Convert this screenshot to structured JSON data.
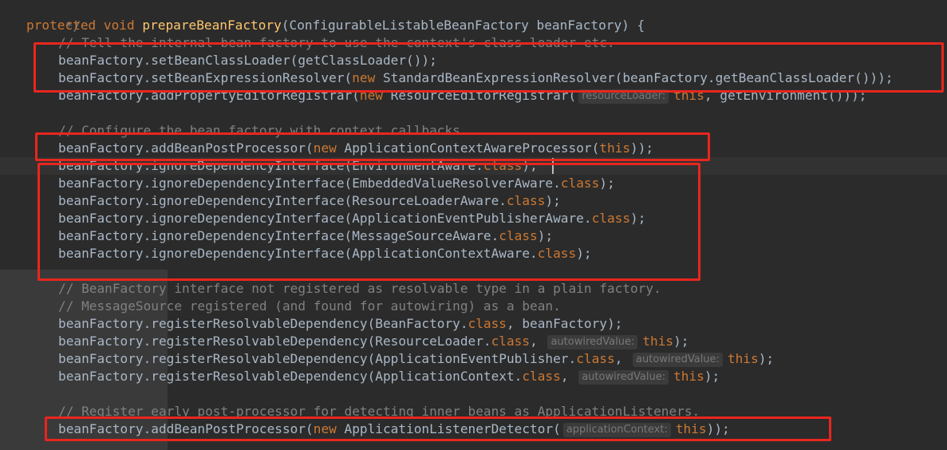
{
  "code": {
    "l0_comment_end": "*/",
    "l1": {
      "kw1": "protected",
      "kw2": "void",
      "method": "prepareBeanFactory",
      "params": "(ConfigurableListableBeanFactory beanFactory) {"
    },
    "l2_comment": "// Tell the internal bean factory to use the context's class loader etc.",
    "l3": "beanFactory.setBeanClassLoader(getClassLoader());",
    "l4": {
      "a": "beanFactory.setBeanExpressionResolver(",
      "kw": "new",
      "b": " StandardBeanExpressionResolver(beanFactory.getBeanClassLoader()));"
    },
    "l5": {
      "a": "beanFactory.addPropertyEditorRegistrar(",
      "kw": "new",
      "b": " ResourceEditorRegistrar(",
      "hint": "resourceLoader:",
      "this": "this",
      "c": ", getEnvironment()));"
    },
    "l6_comment": "// Configure the bean factory with context callbacks.",
    "l7": {
      "a": "beanFactory.addBeanPostProcessor(",
      "kw": "new",
      "b": " ApplicationContextAwareProcessor(",
      "this": "this",
      "c": "));"
    },
    "l8": {
      "a": "beanFactory.ignoreDependencyInterface(EnvironmentAware.",
      "kw": "class",
      "c": ");"
    },
    "l9": {
      "a": "beanFactory.ignoreDependencyInterface(EmbeddedValueResolverAware.",
      "kw": "class",
      "c": ");"
    },
    "l10": {
      "a": "beanFactory.ignoreDependencyInterface(ResourceLoaderAware.",
      "kw": "class",
      "c": ");"
    },
    "l11": {
      "a": "beanFactory.ignoreDependencyInterface(ApplicationEventPublisherAware.",
      "kw": "class",
      "c": ");"
    },
    "l12": {
      "a": "beanFactory.ignoreDependencyInterface(MessageSourceAware.",
      "kw": "class",
      "c": ");"
    },
    "l13": {
      "a": "beanFactory.ignoreDependencyInterface(ApplicationContextAware.",
      "kw": "class",
      "c": ");"
    },
    "l14_comment": "// BeanFactory interface not registered as resolvable type in a plain factory.",
    "l15_comment": "// MessageSource registered (and found for autowiring) as a bean.",
    "l16": {
      "a": "beanFactory.registerResolvableDependency(BeanFactory.",
      "kw": "class",
      "c": ", beanFactory);"
    },
    "l17": {
      "a": "beanFactory.registerResolvableDependency(ResourceLoader.",
      "kw": "class",
      "c": ", ",
      "hint": "autowiredValue:",
      "this": "this",
      "d": ");"
    },
    "l18": {
      "a": "beanFactory.registerResolvableDependency(ApplicationEventPublisher.",
      "kw": "class",
      "c": ", ",
      "hint": "autowiredValue:",
      "this": "this",
      "d": ");"
    },
    "l19": {
      "a": "beanFactory.registerResolvableDependency(ApplicationContext.",
      "kw": "class",
      "c": ", ",
      "hint": "autowiredValue:",
      "this": "this",
      "d": ");"
    },
    "l20_comment": "// Register early post-processor for detecting inner beans as ApplicationListeners.",
    "l21": {
      "a": "beanFactory.addBeanPostProcessor(",
      "kw": "new",
      "b": " ApplicationListenerDetector(",
      "hint": "applicationContext:",
      "this": "this",
      "c": "));"
    }
  },
  "colors": {
    "background": "#2b2b2b",
    "keyword": "#cc7832",
    "method_declaration": "#ffc66d",
    "comment": "#808080",
    "identifier": "#a9b7c6",
    "annotation_box": "#e8261e"
  }
}
